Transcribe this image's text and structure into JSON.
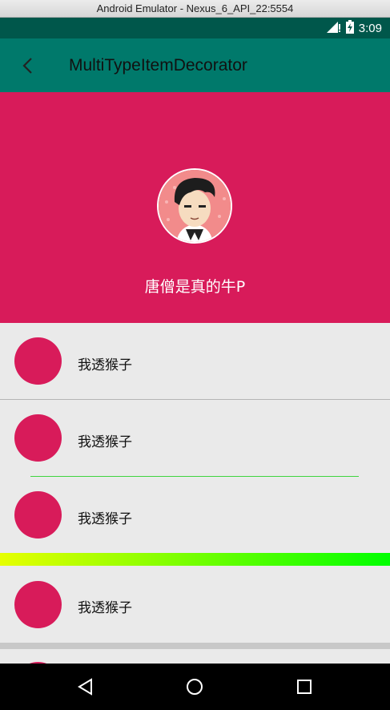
{
  "window": {
    "title": "Android Emulator - Nexus_6_API_22:5554"
  },
  "status_bar": {
    "time": "3:09",
    "icons": [
      "signal-icon",
      "battery-charging-icon"
    ]
  },
  "app_bar": {
    "title": "MultiTypeItemDecorator",
    "back_icon": "back-arrow-icon"
  },
  "header": {
    "name": "唐僧是真的牛P",
    "avatar": "avatar-cartoon-boy"
  },
  "list": {
    "items": [
      {
        "label": "我透猴子"
      },
      {
        "label": "我透猴子"
      },
      {
        "label": "我透猴子"
      },
      {
        "label": "我透猴子"
      }
    ]
  },
  "colors": {
    "accent": "#d81b5a",
    "app_bar": "#00796b",
    "status_bar": "#00574b",
    "gradient_start": "#e6ff00",
    "gradient_end": "#00ff00",
    "green_divider": "#3fd43f"
  },
  "nav": {
    "icons": [
      "back-triangle-icon",
      "home-circle-icon",
      "recents-square-icon"
    ]
  }
}
